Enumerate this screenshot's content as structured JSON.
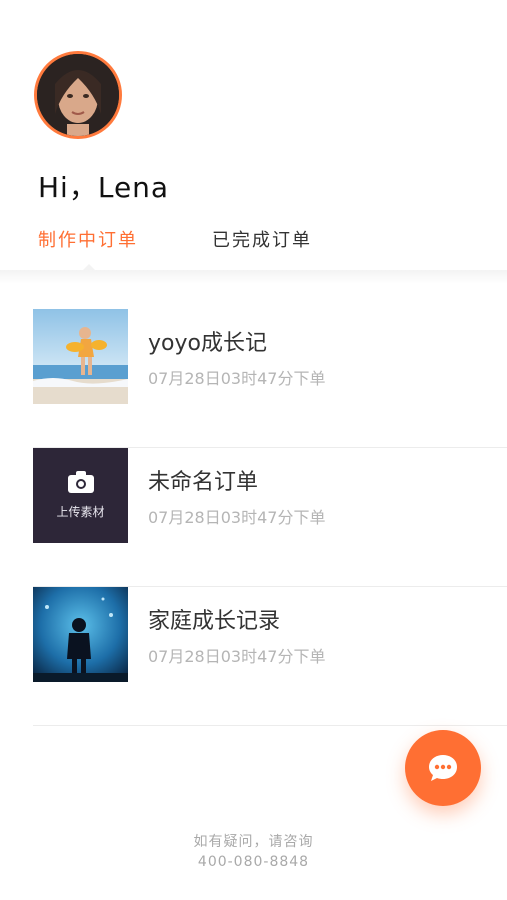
{
  "greeting": "Hi，Lena",
  "tabs": [
    {
      "label": "制作中订单",
      "active": true
    },
    {
      "label": "已完成订单",
      "active": false
    }
  ],
  "orders": [
    {
      "title": "yoyo成长记",
      "time": "07月28日03时47分下单",
      "thumb": "beach-photo"
    },
    {
      "title": "未命名订单",
      "time": "07月28日03时47分下单",
      "thumb": "upload-placeholder",
      "upload_label": "上传素材"
    },
    {
      "title": "家庭成长记录",
      "time": "07月28日03时47分下单",
      "thumb": "aquarium-photo"
    }
  ],
  "footer": {
    "line1": "如有疑问，请咨询",
    "phone": "400-080-8848"
  },
  "colors": {
    "accent": "#ff6f33",
    "upload_bg": "#2d2638"
  },
  "icons": {
    "fab": "chat-bubble-icon",
    "upload": "camera-icon"
  }
}
